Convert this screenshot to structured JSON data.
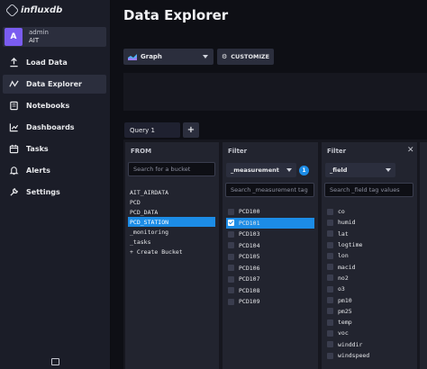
{
  "app": {
    "logo_text": "influxdb"
  },
  "user": {
    "initial": "A",
    "name": "admin",
    "org": "AIT"
  },
  "nav": [
    {
      "label": "Load Data",
      "icon": "upload-icon"
    },
    {
      "label": "Data Explorer",
      "icon": "graph-line-icon",
      "active": true
    },
    {
      "label": "Notebooks",
      "icon": "notebook-icon"
    },
    {
      "label": "Dashboards",
      "icon": "dashboard-icon"
    },
    {
      "label": "Tasks",
      "icon": "calendar-icon"
    },
    {
      "label": "Alerts",
      "icon": "bell-icon"
    },
    {
      "label": "Settings",
      "icon": "wrench-icon"
    }
  ],
  "page": {
    "title": "Data Explorer"
  },
  "toolbar": {
    "graph_type": "Graph",
    "customize_label": "CUSTOMIZE"
  },
  "query": {
    "tab_label": "Query 1",
    "add_label": "+"
  },
  "from": {
    "header": "FROM",
    "search_placeholder": "Search for a bucket",
    "buckets": [
      "AIT_AIRDATA",
      "PCD",
      "PCD_DATA",
      "PCD_STATION",
      "_monitoring",
      "_tasks",
      "+ Create Bucket"
    ],
    "selected": "PCD_STATION"
  },
  "filter1": {
    "header": "Filter",
    "key": "_measurement",
    "count": "1",
    "search_placeholder": "Search _measurement tag",
    "values": [
      "PCD100",
      "PCD101",
      "PCD103",
      "PCD104",
      "PCD105",
      "PCD106",
      "PCD107",
      "PCD108",
      "PCD109"
    ],
    "selected": "PCD101"
  },
  "filter2": {
    "header": "Filter",
    "close": "✕",
    "key": "_field",
    "search_placeholder": "Search _field tag values",
    "values": [
      "co",
      "humid",
      "lat",
      "logtime",
      "lon",
      "macid",
      "no2",
      "o3",
      "pm10",
      "pm25",
      "temp",
      "voc",
      "winddir",
      "windspeed"
    ]
  },
  "colors": {
    "accent": "#1c8ce6",
    "sidebar": "#1b1d28",
    "background": "#0e0f15",
    "avatar": "#7a5cf0"
  }
}
